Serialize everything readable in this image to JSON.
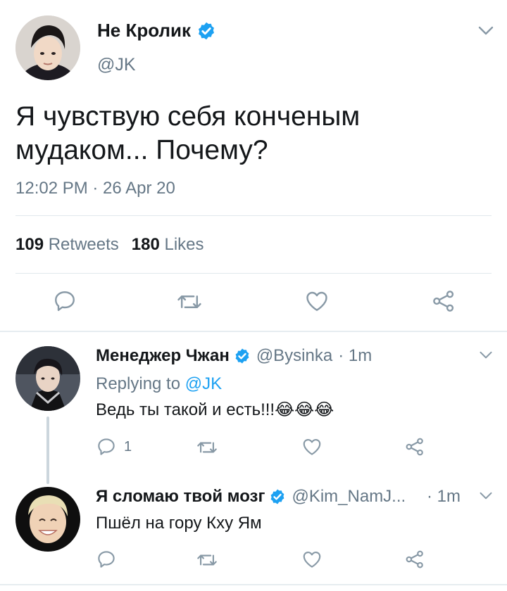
{
  "tweet": {
    "author_name": "Не Кролик",
    "handle": "@JK",
    "text": "Я чувствую себя конченым мудаком... Почему?",
    "timestamp": "12:02 PM · 26 Apr 20",
    "retweets_count": "109",
    "retweets_label": "Retweets",
    "likes_count": "180",
    "likes_label": "Likes"
  },
  "replies": [
    {
      "author_name": "Менеджер Чжан",
      "handle": "@Bysinka",
      "time": "· 1m",
      "replying_prefix": "Replying to",
      "replying_to": "@JK",
      "text": "Ведь ты такой и есть!!!",
      "emoji": "😂😂😂",
      "reply_count": "1"
    },
    {
      "author_name": "Я сломаю твой мозг",
      "handle": "@Kim_NamJ...",
      "time": "· 1m",
      "text": "Пшёл на гору Кху Ям"
    }
  ],
  "colors": {
    "accent": "#1da1f2",
    "secondary_text": "#657786",
    "icon": "#8899a6"
  }
}
